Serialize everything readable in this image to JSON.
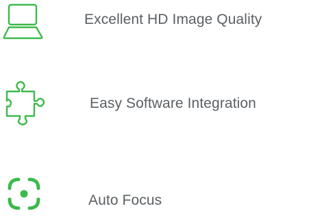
{
  "theme": {
    "accent": "#3cb94a",
    "text": "#5a5f63",
    "background": "#ffffff"
  },
  "features": [
    {
      "icon": "laptop-icon",
      "label": "Excellent HD Image Quality"
    },
    {
      "icon": "puzzle-piece-icon",
      "label": "Easy Software Integration"
    },
    {
      "icon": "focus-target-icon",
      "label": "Auto Focus"
    }
  ]
}
